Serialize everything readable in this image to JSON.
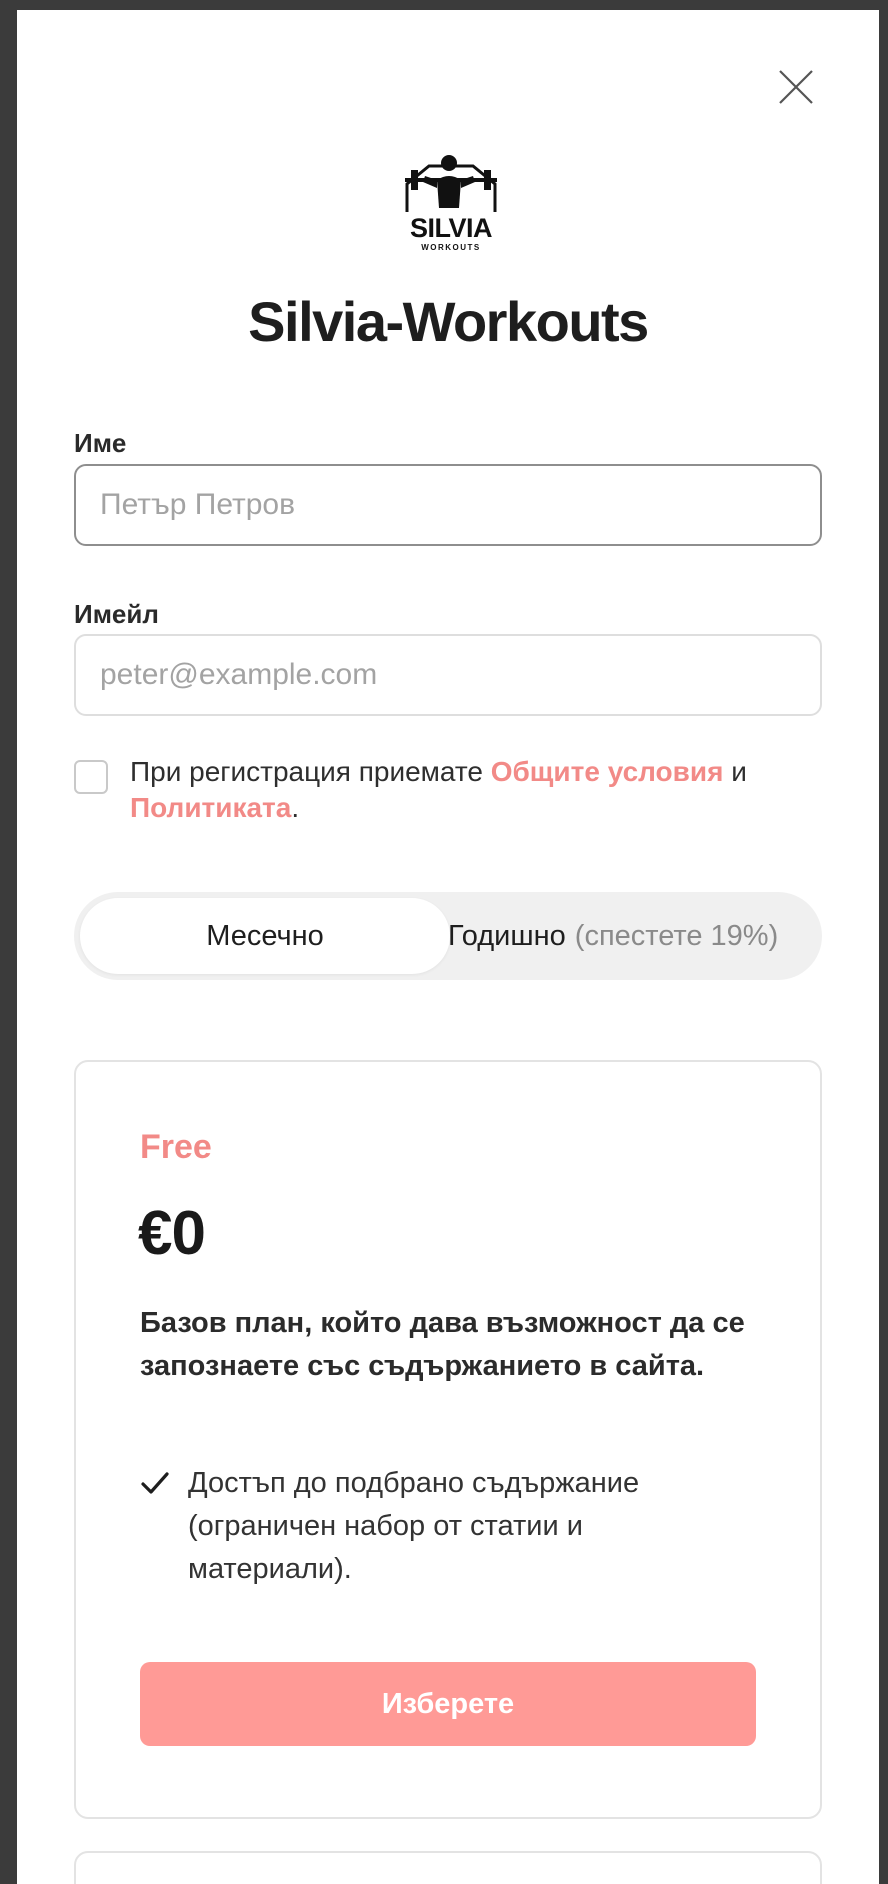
{
  "site": {
    "title": "Silvia-Workouts",
    "logo_text": "SILVIA",
    "logo_subtext": "WORKOUTS"
  },
  "form": {
    "name_label": "Име",
    "name_placeholder": "Петър Петров",
    "email_label": "Имейл",
    "email_placeholder": "peter@example.com",
    "consent_prefix": "При регистрация приемате ",
    "terms_link": "Общите условия",
    "consent_and": " и ",
    "policy_link": "Политиката",
    "consent_suffix": "."
  },
  "billing_toggle": {
    "monthly": "Месечно",
    "yearly": "Годишно",
    "yearly_savings": "(спестете 19%)",
    "selected": "monthly"
  },
  "plans": [
    {
      "name": "Free",
      "price": "€0",
      "description": "Базов план, който дава възможност да се запознаете със съдържанието в сайта.",
      "features": [
        "Достъп до подбрано съдържание (ограничен набор от статии и материали)."
      ],
      "button_label": "Изберете"
    }
  ],
  "colors": {
    "accent": "#f28a87",
    "button": "#ff9a96",
    "backdrop": "#3b3b3b"
  },
  "icons": {
    "close": "close-icon",
    "check": "check-icon"
  }
}
